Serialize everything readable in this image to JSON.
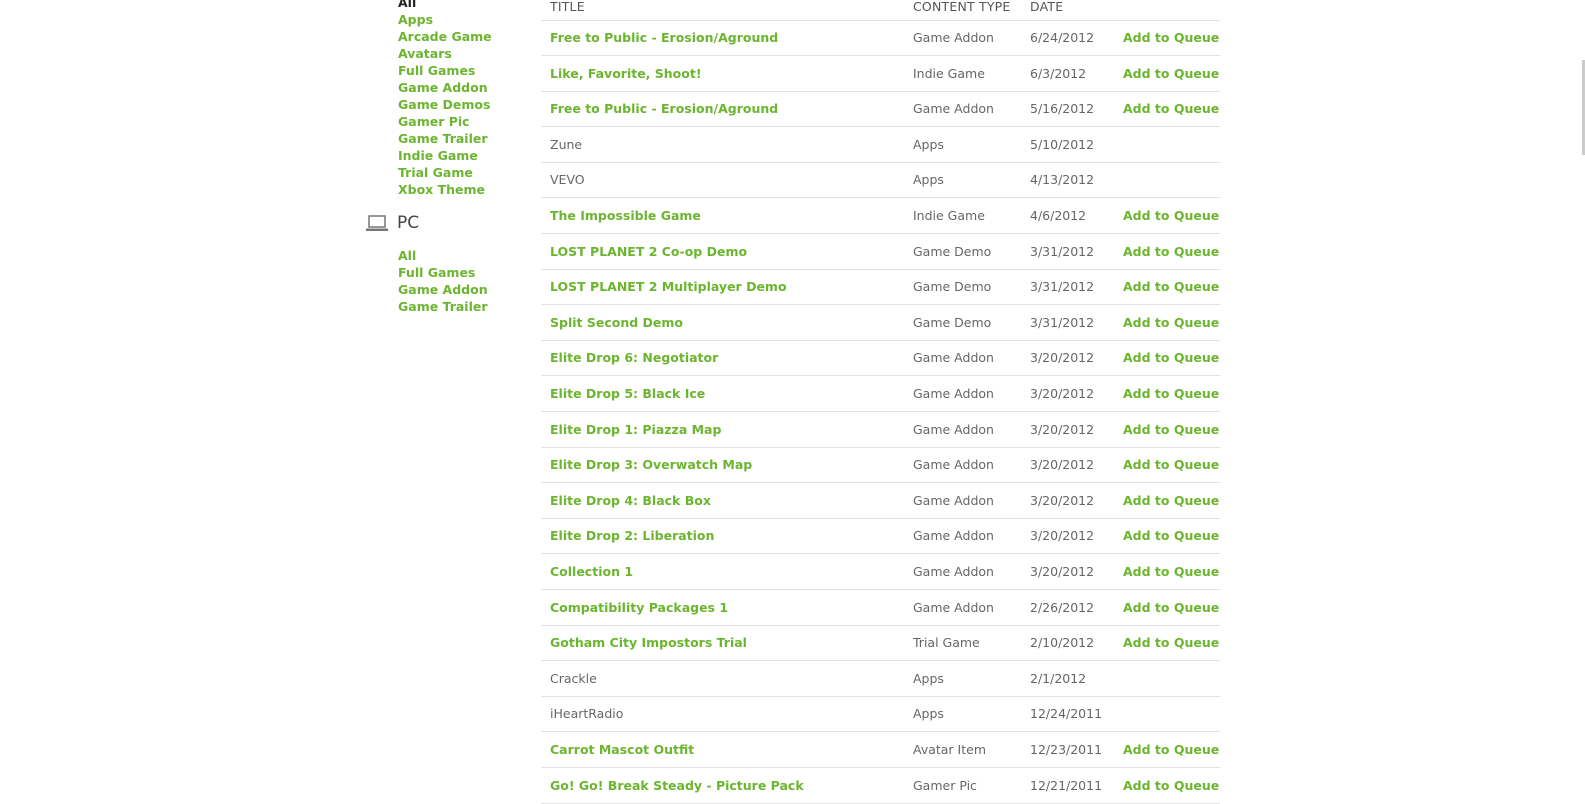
{
  "sidebar": {
    "xbox_categories": [
      "All",
      "Apps",
      "Arcade Game",
      "Avatars",
      "Full Games",
      "Game Addon",
      "Game Demos",
      "Gamer Pic",
      "Game Trailer",
      "Indie Game",
      "Trial Game",
      "Xbox Theme"
    ],
    "pc_heading": "PC",
    "pc_categories": [
      "All",
      "Full Games",
      "Game Addon",
      "Game Trailer"
    ]
  },
  "table": {
    "headers": {
      "title": "TITLE",
      "content_type": "CONTENT TYPE",
      "date": "DATE"
    },
    "rows": [
      {
        "title": "Free to Public - Erosion/Aground",
        "type": "Game Addon",
        "date": "6/24/2012",
        "action": "Add to Queue"
      },
      {
        "title": "Like, Favorite, Shoot!",
        "type": "Indie Game",
        "date": "6/3/2012",
        "action": "Add to Queue"
      },
      {
        "title": "Free to Public - Erosion/Aground",
        "type": "Game Addon",
        "date": "5/16/2012",
        "action": "Add to Queue"
      },
      {
        "title": "Zune",
        "type": "Apps",
        "date": "5/10/2012",
        "action": ""
      },
      {
        "title": "VEVO",
        "type": "Apps",
        "date": "4/13/2012",
        "action": ""
      },
      {
        "title": "The Impossible Game",
        "type": "Indie Game",
        "date": "4/6/2012",
        "action": "Add to Queue"
      },
      {
        "title": "LOST PLANET 2 Co-op Demo",
        "type": "Game Demo",
        "date": "3/31/2012",
        "action": "Add to Queue"
      },
      {
        "title": "LOST PLANET 2 Multiplayer Demo",
        "type": "Game Demo",
        "date": "3/31/2012",
        "action": "Add to Queue"
      },
      {
        "title": "Split Second Demo",
        "type": "Game Demo",
        "date": "3/31/2012",
        "action": "Add to Queue"
      },
      {
        "title": "Elite Drop 6: Negotiator",
        "type": "Game Addon",
        "date": "3/20/2012",
        "action": "Add to Queue"
      },
      {
        "title": "Elite Drop 5: Black Ice",
        "type": "Game Addon",
        "date": "3/20/2012",
        "action": "Add to Queue"
      },
      {
        "title": "Elite Drop 1: Piazza Map",
        "type": "Game Addon",
        "date": "3/20/2012",
        "action": "Add to Queue"
      },
      {
        "title": "Elite Drop 3: Overwatch Map",
        "type": "Game Addon",
        "date": "3/20/2012",
        "action": "Add to Queue"
      },
      {
        "title": "Elite Drop 4: Black Box",
        "type": "Game Addon",
        "date": "3/20/2012",
        "action": "Add to Queue"
      },
      {
        "title": "Elite Drop 2: Liberation",
        "type": "Game Addon",
        "date": "3/20/2012",
        "action": "Add to Queue"
      },
      {
        "title": "Collection 1",
        "type": "Game Addon",
        "date": "3/20/2012",
        "action": "Add to Queue"
      },
      {
        "title": "Compatibility Packages 1",
        "type": "Game Addon",
        "date": "2/26/2012",
        "action": "Add to Queue"
      },
      {
        "title": "Gotham City Impostors Trial",
        "type": "Trial Game",
        "date": "2/10/2012",
        "action": "Add to Queue"
      },
      {
        "title": "Crackle",
        "type": "Apps",
        "date": "2/1/2012",
        "action": ""
      },
      {
        "title": "iHeartRadio",
        "type": "Apps",
        "date": "12/24/2011",
        "action": ""
      },
      {
        "title": "Carrot Mascot Outfit",
        "type": "Avatar Item",
        "date": "12/23/2011",
        "action": "Add to Queue"
      },
      {
        "title": "Go! Go! Break Steady - Picture Pack",
        "type": "Gamer Pic",
        "date": "12/21/2011",
        "action": "Add to Queue"
      }
    ]
  },
  "colors": {
    "accent": "#6cb52f",
    "text": "#666666",
    "divider": "#e2e2e2"
  },
  "icons": {
    "pc": "laptop-icon"
  }
}
